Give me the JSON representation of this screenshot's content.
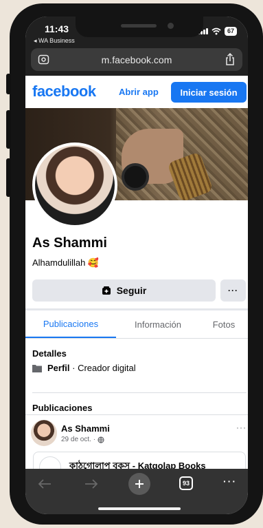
{
  "status": {
    "time": "11:43",
    "back_app": "◂ WA Business",
    "battery": "67"
  },
  "browser": {
    "url": "m.facebook.com"
  },
  "header": {
    "logo": "facebook",
    "open_app": "Abrir app",
    "login": "Iniciar sesión"
  },
  "profile": {
    "name": "As Shammi",
    "bio": "Alhamdulillah 🥰"
  },
  "actions": {
    "follow": "Seguir",
    "more": "···"
  },
  "tabs": [
    {
      "label": "Publicaciones",
      "active": true
    },
    {
      "label": "Información",
      "active": false
    },
    {
      "label": "Fotos",
      "active": false
    }
  ],
  "details": {
    "title": "Detalles",
    "label": "Perfil",
    "text": " · Creador digital"
  },
  "posts": {
    "title": "Publicaciones",
    "author": "As Shammi",
    "date": "29 de oct. ·",
    "more": "···",
    "link_title": "কাঠগোলাপ বুকস - Katgolap Books"
  },
  "bottom_bar": {
    "tab_count": "93",
    "menu": "···"
  },
  "colors": {
    "brand_blue": "#1877f2",
    "button_gray": "#e4e6eb",
    "browser_bar": "#202020",
    "bottom_bar": "#333333"
  },
  "icons": [
    "reader-mode-icon",
    "share-icon",
    "wifi-icon",
    "follow-icon",
    "folder-icon",
    "globe-icon",
    "back-arrow-icon",
    "forward-arrow-icon",
    "plus-icon"
  ]
}
